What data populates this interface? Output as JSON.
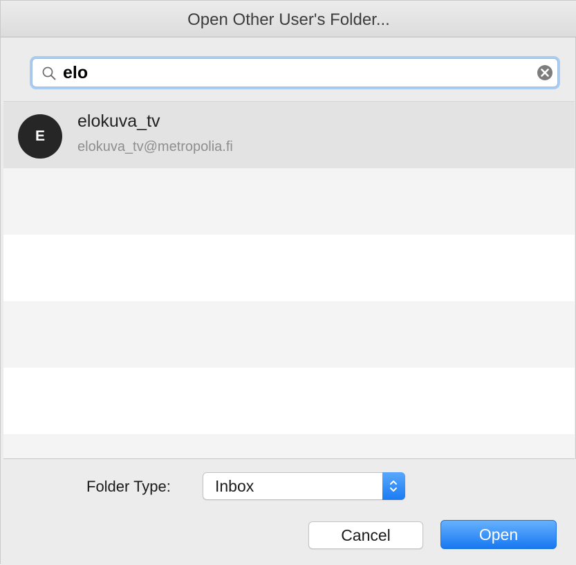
{
  "window": {
    "title": "Open Other User's Folder..."
  },
  "search": {
    "value": "elo"
  },
  "results": [
    {
      "initial": "E",
      "name": "elokuva_tv",
      "email": "elokuva_tv@metropolia.fi"
    }
  ],
  "folder_type": {
    "label": "Folder Type:",
    "selected": "Inbox"
  },
  "buttons": {
    "cancel": "Cancel",
    "open": "Open"
  },
  "colors": {
    "accent": "#1a7bf3",
    "avatar_bg": "#262626",
    "selected_row": "#e3e3e3",
    "stripe_row": "#f4f4f4"
  },
  "icons": {
    "search": "magnifier-icon",
    "clear": "x-circle-icon",
    "stepper": "up-down-chevron-icon"
  }
}
